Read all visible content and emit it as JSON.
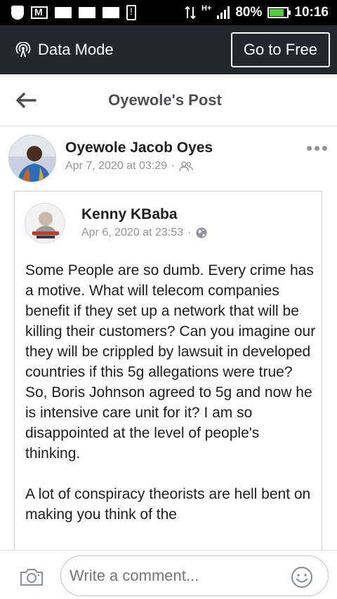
{
  "status_bar": {
    "battery_text": "80%",
    "time": "10:16",
    "network": "H+",
    "battery_level": 0.8
  },
  "data_mode": {
    "label": "Data Mode",
    "button_label": "Go to Free"
  },
  "header": {
    "title": "Oyewole's Post"
  },
  "post": {
    "author": "Oyewole Jacob Oyes",
    "timestamp": "Apr 7, 2020 at 03:29",
    "separator": "·",
    "audience_icon": "friends-icon"
  },
  "shared_post": {
    "author": "Kenny KBaba",
    "timestamp": "Apr 6, 2020 at 23:53",
    "separator": "·",
    "audience_icon": "globe-icon",
    "paragraphs": [
      "Some People are so dumb. Every crime has a motive. What will telecom companies benefit if they set up a network that will be killing their customers? Can you imagine our they will be crippled by lawsuit in developed countries if this 5g allegations were true? So, Boris Johnson agreed to 5g and now he is intensive care unit for it? I am so disappointed at the level of people's thinking.",
      "A lot of conspiracy theorists are hell bent on making you think of the"
    ]
  },
  "comment_bar": {
    "placeholder": "Write a comment...",
    "camera_icon": "camera-icon",
    "emoji_icon": "emoji-icon"
  },
  "colors": {
    "status_bar_bg": "#000000",
    "data_bar_bg": "#23272e",
    "battery_fill": "#4cd137",
    "meta_text": "#90949c",
    "header_title": "#4b4f56"
  }
}
